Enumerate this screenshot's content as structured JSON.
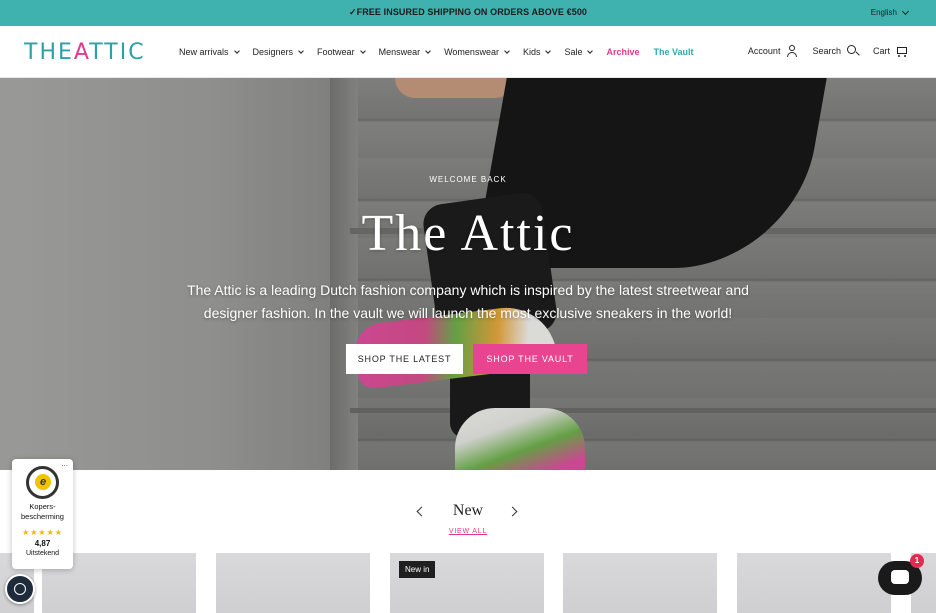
{
  "announcement": {
    "text": "✓FREE INSURED SHIPPING ON ORDERS ABOVE €500",
    "language": "English"
  },
  "header": {
    "logo": {
      "pre": "THE",
      "a": "A",
      "post": "TTIC"
    },
    "nav": [
      {
        "label": "New arrivals",
        "dropdown": true
      },
      {
        "label": "Designers",
        "dropdown": true
      },
      {
        "label": "Footwear",
        "dropdown": true
      },
      {
        "label": "Menswear",
        "dropdown": true
      },
      {
        "label": "Womenswear",
        "dropdown": true
      },
      {
        "label": "Kids",
        "dropdown": true
      },
      {
        "label": "Sale",
        "dropdown": true
      },
      {
        "label": "Archive",
        "dropdown": false
      },
      {
        "label": "The Vault",
        "dropdown": false
      }
    ],
    "account_label": "Account",
    "search_label": "Search",
    "cart_label": "Cart"
  },
  "hero": {
    "eyebrow": "WELCOME BACK",
    "title": "The Attic",
    "description": "The Attic is a leading Dutch fashion company which is inspired by the latest streetwear and designer fashion. In the vault we will launch the most exclusive sneakers in the world!",
    "primary_button": "SHOP THE LATEST",
    "secondary_button": "SHOP THE VAULT"
  },
  "new_section": {
    "title": "New",
    "view_all": "VIEW ALL",
    "badge": "New in"
  },
  "trust_badge": {
    "label_line1": "Kopers-",
    "label_line2": "bescherming",
    "stars": "★★★★★",
    "score": "4,87",
    "grade": "Uitstekend",
    "menu": "..."
  },
  "chat": {
    "unread": "1"
  },
  "colors": {
    "accent_teal": "#3fb2b0",
    "accent_pink": "#e8448f"
  }
}
